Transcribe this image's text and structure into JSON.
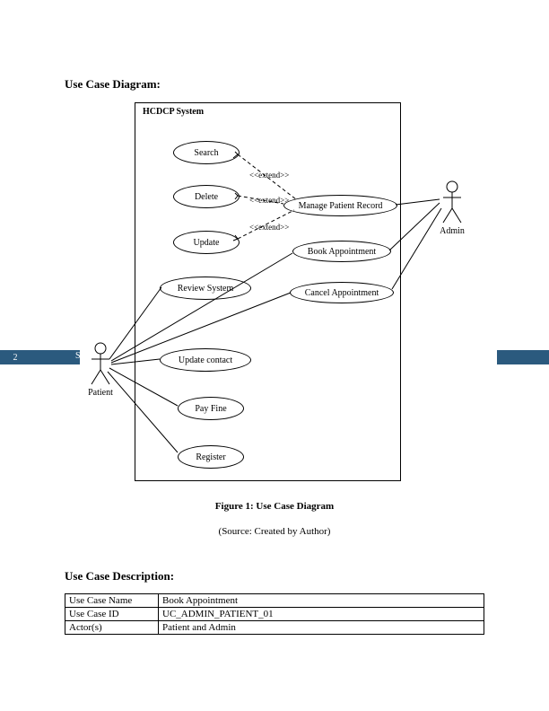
{
  "page_number": "2",
  "headings": {
    "diagram": "Use Case Diagram:",
    "description": "Use Case Description:"
  },
  "figure": {
    "caption": "Figure 1: Use Case Diagram",
    "source": "(Source: Created by Author)",
    "system_title": "HCDCP System"
  },
  "actors": {
    "left": "Patient",
    "right": "Admin"
  },
  "usecases": {
    "search": "Search",
    "delete": "Delete",
    "update": "Update",
    "review": "Review System",
    "update_contact": "Update contact",
    "pay_fine": "Pay Fine",
    "register": "Register",
    "manage_record": "Manage Patient Record",
    "book_appt": "Book Appointment",
    "cancel_appt": "Cancel Appointment"
  },
  "extend_label": "<<extend>>",
  "table": {
    "r0h": "Use Case Name",
    "r0v": "Book Appointment",
    "r1h": "Use Case ID",
    "r1v": "UC_ADMIN_PATIENT_01",
    "r2h": "Actor(s)",
    "r2v": "Patient and Admin"
  },
  "side_letter": "S"
}
